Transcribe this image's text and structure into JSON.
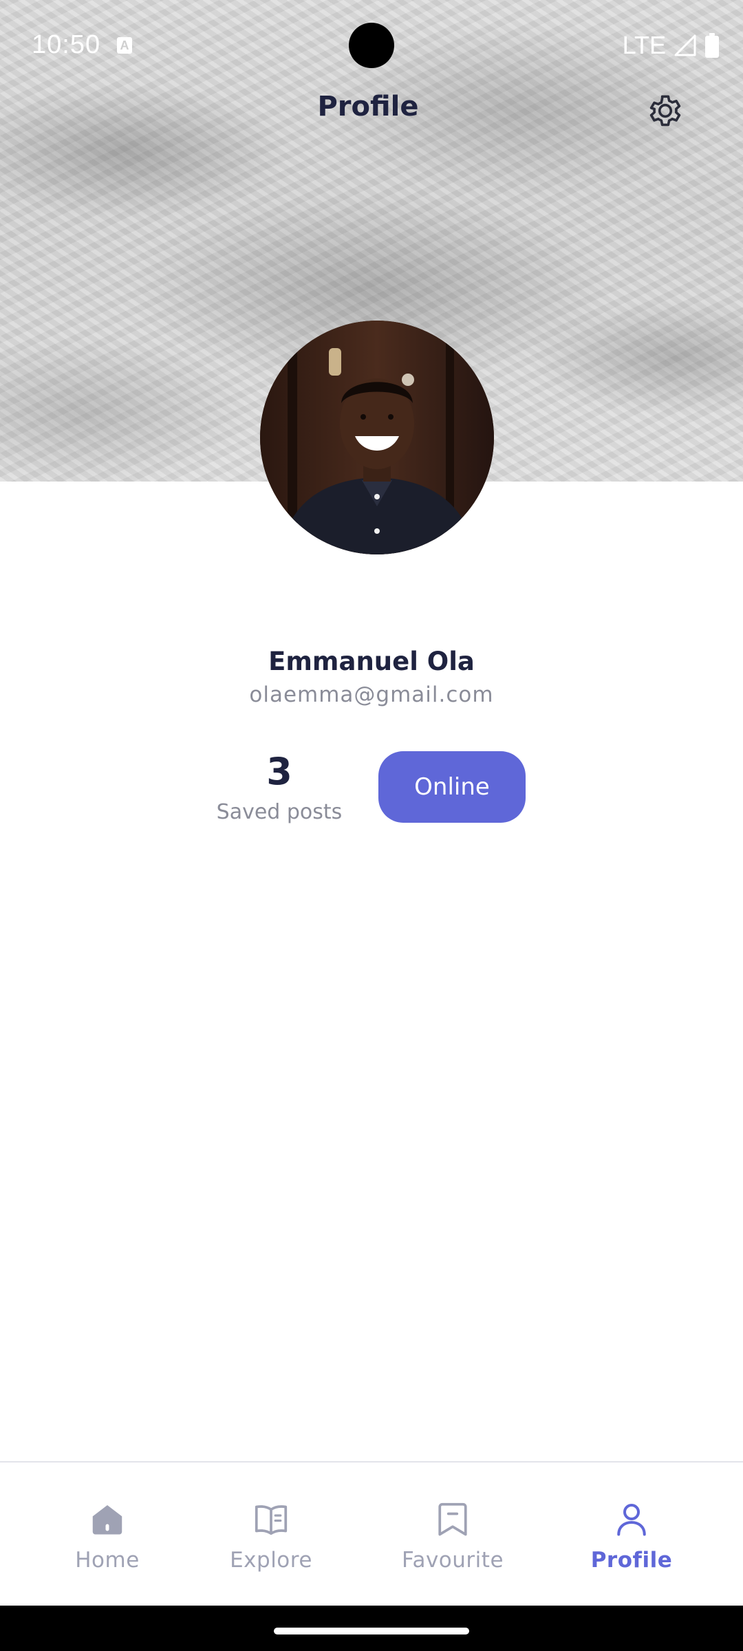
{
  "status_bar": {
    "time": "10:50",
    "network": "LTE",
    "icons": [
      "notification-a-icon",
      "signal-icon",
      "battery-icon"
    ]
  },
  "header": {
    "title": "Profile",
    "settings_icon": "gear-icon"
  },
  "profile": {
    "name": "Emmanuel Ola",
    "email": "olaemma@gmail.com",
    "saved_posts_count": "3",
    "saved_posts_label": "Saved posts",
    "status": "Online"
  },
  "bottom_nav": {
    "items": [
      {
        "label": "Home",
        "icon": "home-icon",
        "active": false
      },
      {
        "label": "Explore",
        "icon": "book-icon",
        "active": false
      },
      {
        "label": "Favourite",
        "icon": "bookmark-icon",
        "active": false
      },
      {
        "label": "Profile",
        "icon": "user-icon",
        "active": true
      }
    ]
  },
  "colors": {
    "accent": "#5f67d8",
    "title_text": "#1f2340",
    "muted_text": "#8a8c98",
    "nav_inactive": "#9fa2b4"
  }
}
